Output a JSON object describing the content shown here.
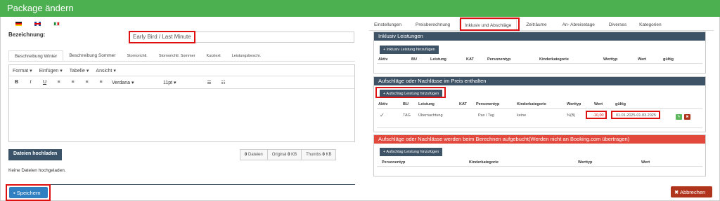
{
  "window": {
    "title": "Package ändern"
  },
  "left": {
    "label_bezeichnung": "Bezeichnung:",
    "bezeichnung_value": "Early Bird / Last Minute",
    "tabs": [
      "Beschreibung Winter",
      "Beschreibung Sommer",
      "Stornorichtl.",
      "Stornorichtl. Sommer",
      "Kurztext",
      "Leistungsbeschr."
    ],
    "menu": [
      "Format",
      "Einfügen",
      "Tabelle",
      "Ansicht"
    ],
    "font_family": "Verdana",
    "font_size": "11pt",
    "tools": [
      "B",
      "I",
      "U",
      "≡",
      "≡",
      "≡",
      "≡"
    ],
    "upload_label": "Dateien hochladen",
    "counts": {
      "files_num": "0",
      "files_lbl": "Dateien",
      "original_lbl": "Original",
      "original_val": "0",
      "original_unit": "KB",
      "thumbs_lbl": "Thumbs",
      "thumbs_val": "0",
      "thumbs_unit": "KB"
    },
    "no_files_text": "Keine Dateien hochgeladen.",
    "save_label": "Speichern"
  },
  "right": {
    "tabs": [
      "Einstellungen",
      "Preisberechnung",
      "Inklusiv und Abschläge",
      "Zeiträume",
      "An- Abreisetage",
      "Diverses",
      "Kategorien"
    ],
    "panel1": {
      "title": "Inklusiv Leistungen",
      "add_label": "+ Inklusiv Leistung hinzufügen",
      "headers": [
        "Aktiv",
        "BU",
        "Leistung",
        "KAT",
        "Personentyp",
        "Kinderkategorie",
        "Werttyp",
        "Wert",
        "gültig"
      ]
    },
    "panel2": {
      "title": "Aufschläge oder Nachlässe im Preis enthalten",
      "add_label": "+ Aufschlag Leistung hinzufügen",
      "headers": [
        "Aktiv",
        "BU",
        "Leistung",
        "KAT",
        "Personentyp",
        "Kinderkategorie",
        "Werttyp",
        "Wert",
        "gültig"
      ],
      "row": {
        "aktiv": "✓",
        "bu": "TAG",
        "leistung": "Übernachtung",
        "kat": "",
        "personentyp": "Pax / Tag",
        "kinderkategorie": "keine",
        "werttyp": "%(B)",
        "wert": "-10,00",
        "gueltig": "01.01.2025-01.03.2025"
      }
    },
    "panel3": {
      "title": "Aufschläge oder Nachlässe werden beim Berechnen aufgebucht(Werden nicht an Booking.com übertragen)",
      "add_label": "+ Aufschlag Leistung hinzufügen",
      "headers": [
        "Personentyp",
        "Kinderkategorie",
        "Werttyp",
        "Wert"
      ]
    },
    "cancel_label": "✖ Abbrechen"
  }
}
